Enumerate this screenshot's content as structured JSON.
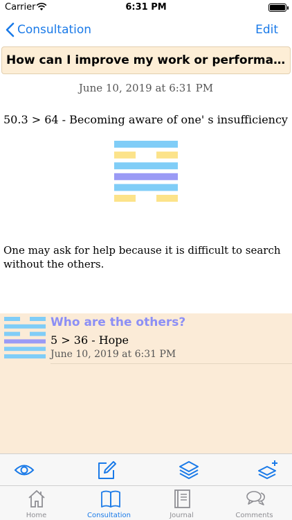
{
  "status_bar": {
    "carrier": "Carrier",
    "time": "6:31 PM"
  },
  "nav": {
    "back_label": "Consultation",
    "edit_label": "Edit"
  },
  "question": "How can I improve my work or performance?",
  "date": "June 10, 2019 at 6:31 PM",
  "hexagram": {
    "title": "50.3 > 64 - Becoming aware of one' s insufficiency",
    "lines": [
      {
        "color": "#80cdf7",
        "type": "solid"
      },
      {
        "color": "#fce38a",
        "type": "broken"
      },
      {
        "color": "#80cdf7",
        "type": "solid"
      },
      {
        "color": "#9a9af5",
        "type": "solid"
      },
      {
        "color": "#80cdf7",
        "type": "solid"
      },
      {
        "color": "#fce38a",
        "type": "broken"
      }
    ]
  },
  "interpretation": "One may ask for help because it is difficult to search without the others.",
  "comment": {
    "title": "Who are the others?",
    "subtitle": "5 > 36 - Hope",
    "date": "June 10, 2019 at 6:31 PM",
    "lines": [
      {
        "color": "#80cdf7",
        "type": "broken"
      },
      {
        "color": "#80cdf7",
        "type": "solid"
      },
      {
        "color": "#80cdf7",
        "type": "broken"
      },
      {
        "color": "#9a9af5",
        "type": "solid"
      },
      {
        "color": "#80cdf7",
        "type": "solid"
      },
      {
        "color": "#80cdf7",
        "type": "solid"
      }
    ]
  },
  "tabs": [
    {
      "label": "Home",
      "icon": "home-icon",
      "active": false
    },
    {
      "label": "Consultation",
      "icon": "book-icon",
      "active": true
    },
    {
      "label": "Journal",
      "icon": "journal-icon",
      "active": false
    },
    {
      "label": "Comments",
      "icon": "comments-icon",
      "active": false
    }
  ],
  "toolbar": [
    "eye-icon",
    "edit-icon",
    "layers-icon",
    "add-layer-icon"
  ],
  "colors": {
    "accent": "#1a7ae8",
    "banner": "#fdeed6",
    "comment_bg": "#fbebd7",
    "comment_title": "#8c8ff5"
  }
}
